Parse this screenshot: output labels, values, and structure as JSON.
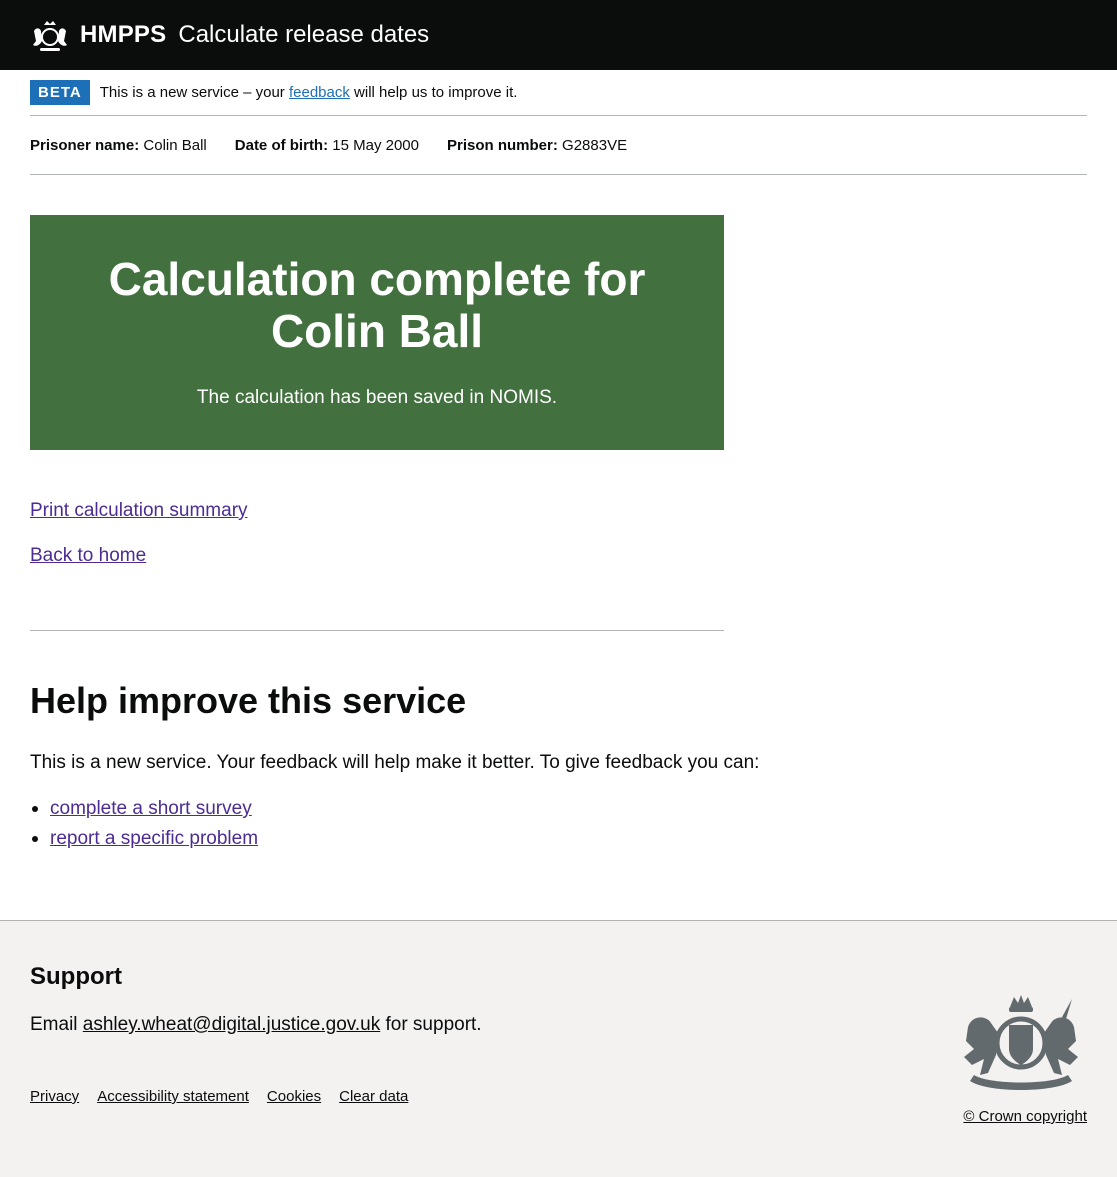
{
  "header": {
    "brand": "HMPPS",
    "service_name": "Calculate release dates"
  },
  "phase_banner": {
    "tag": "BETA",
    "text_before": "This is a new service – your ",
    "link_text": "feedback",
    "text_after": " will help us to improve it."
  },
  "prisoner": {
    "name_label": "Prisoner name:",
    "name": "Colin Ball",
    "dob_label": "Date of birth:",
    "dob": "15 May 2000",
    "number_label": "Prison number:",
    "number": "G2883VE"
  },
  "panel": {
    "title_line1": "Calculation complete for",
    "title_line2": "Colin Ball",
    "body": "The calculation has been saved in NOMIS."
  },
  "links": {
    "print": "Print calculation summary",
    "home": "Back to home"
  },
  "help": {
    "title": "Help improve this service",
    "text": "This is a new service. Your feedback will help make it better. To give feedback you can:",
    "items": [
      "complete a short survey",
      "report a specific problem"
    ]
  },
  "footer": {
    "support_title": "Support",
    "support_prefix": "Email ",
    "support_email": "ashley.wheat@digital.justice.gov.uk",
    "support_suffix": " for support.",
    "links": [
      "Privacy",
      "Accessibility statement",
      "Cookies",
      "Clear data"
    ],
    "copyright": "© Crown copyright"
  },
  "colors": {
    "header_bg": "#0b0c0c",
    "panel_bg": "#42703f",
    "phase_tag_bg": "#1d70b8",
    "link": "#4c2c92",
    "footer_bg": "#f3f2f1"
  }
}
